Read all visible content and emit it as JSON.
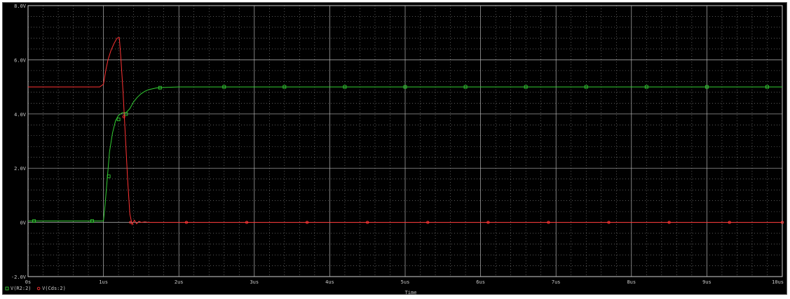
{
  "chart_data": {
    "type": "line",
    "xlabel": "Time",
    "x_unit": "us",
    "xlim": [
      0,
      10
    ],
    "ylim": [
      -2,
      8
    ],
    "x_ticks": [
      {
        "value": 0,
        "label": "0s"
      },
      {
        "value": 1,
        "label": "1us"
      },
      {
        "value": 2,
        "label": "2us"
      },
      {
        "value": 3,
        "label": "3us"
      },
      {
        "value": 4,
        "label": "4us"
      },
      {
        "value": 5,
        "label": "5us"
      },
      {
        "value": 6,
        "label": "6us"
      },
      {
        "value": 7,
        "label": "7us"
      },
      {
        "value": 8,
        "label": "8us"
      },
      {
        "value": 9,
        "label": "9us"
      },
      {
        "value": 10,
        "label": "10us"
      }
    ],
    "y_ticks": [
      {
        "value": -2,
        "label": "-2.0V"
      },
      {
        "value": 0,
        "label": "0V"
      },
      {
        "value": 2,
        "label": "2.0V"
      },
      {
        "value": 4,
        "label": "4.0V"
      },
      {
        "value": 6,
        "label": "6.0V"
      },
      {
        "value": 8,
        "label": "8.0V"
      }
    ],
    "grid": true,
    "legend_position": "bottom-left",
    "background_color": "#000000",
    "grid_color": "#b4b4b4",
    "series": [
      {
        "name": "V(R2:2)",
        "color": "#33cc33",
        "marker": "square",
        "x": [
          0,
          0.3,
          0.7,
          0.95,
          1.0,
          1.02,
          1.05,
          1.08,
          1.12,
          1.16,
          1.2,
          1.25,
          1.3,
          1.35,
          1.4,
          1.45,
          1.5,
          1.55,
          1.6,
          1.7,
          1.8,
          1.9,
          2.0,
          2.5,
          3,
          4,
          5,
          6,
          7,
          8,
          9,
          10
        ],
        "y": [
          0.05,
          0.05,
          0.05,
          0.05,
          0.05,
          0.6,
          1.6,
          2.6,
          3.3,
          3.75,
          3.95,
          4.05,
          4.05,
          4.2,
          4.45,
          4.62,
          4.75,
          4.84,
          4.9,
          4.96,
          4.98,
          4.99,
          5.0,
          5.0,
          5.0,
          5.0,
          5.0,
          5.0,
          5.0,
          5.0,
          5.0,
          5.0
        ],
        "marker_x": [
          0.08,
          0.85,
          1.07,
          1.2,
          1.3,
          1.75,
          2.6,
          3.4,
          4.2,
          5.0,
          5.8,
          6.6,
          7.4,
          8.2,
          9.0,
          9.8
        ],
        "marker_y": [
          0.05,
          0.05,
          1.7,
          3.8,
          4.0,
          4.97,
          5.0,
          5.0,
          5.0,
          5.0,
          5.0,
          5.0,
          5.0,
          5.0,
          5.0,
          5.0
        ]
      },
      {
        "name": "V(Cds:2)",
        "color": "#ff3333",
        "marker": "circle",
        "x": [
          0,
          0.5,
          0.95,
          1.0,
          1.03,
          1.06,
          1.1,
          1.14,
          1.18,
          1.21,
          1.23,
          1.26,
          1.29,
          1.32,
          1.35,
          1.38,
          1.41,
          1.44,
          1.47,
          1.5,
          1.55,
          1.6,
          2.0,
          3,
          4,
          5,
          6,
          7,
          8,
          9,
          10
        ],
        "y": [
          5.0,
          5.0,
          5.0,
          5.1,
          5.6,
          6.0,
          6.35,
          6.6,
          6.8,
          6.82,
          6.1,
          4.8,
          3.2,
          1.6,
          0.3,
          -0.08,
          0.08,
          -0.05,
          0.04,
          0.0,
          0.02,
          0.0,
          0.0,
          0.0,
          0.0,
          0.0,
          0.0,
          0.0,
          0.0,
          0.0,
          0.0
        ],
        "marker_x": [
          1.27,
          1.36,
          2.1,
          2.9,
          3.7,
          4.5,
          5.3,
          6.1,
          6.9,
          7.7,
          8.5,
          9.3,
          10.0
        ],
        "marker_y": [
          3.9,
          0.0,
          0.0,
          0.0,
          0.0,
          0.0,
          0.0,
          0.0,
          0.0,
          0.0,
          0.0,
          0.0,
          0.0
        ]
      }
    ]
  }
}
